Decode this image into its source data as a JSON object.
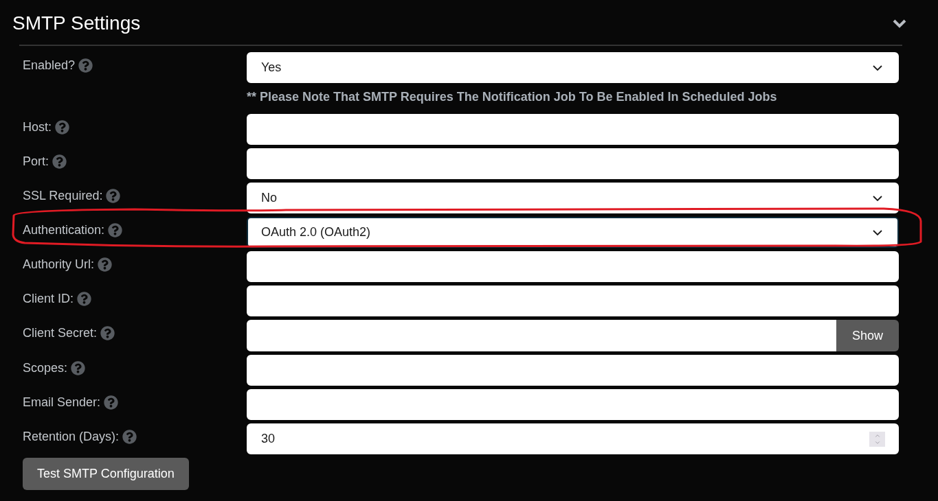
{
  "section": {
    "title": "SMTP Settings",
    "expanded": true
  },
  "note": "** Please Note That SMTP Requires The Notification Job To Be Enabled In Scheduled Jobs",
  "fields": [
    {
      "label": "Enabled?",
      "kind": "select",
      "value": "Yes",
      "focused": false
    },
    {
      "label": "Host:",
      "kind": "text",
      "focused": false
    },
    {
      "label": "Port:",
      "kind": "text",
      "focused": false
    },
    {
      "label": "SSL Required:",
      "kind": "select",
      "value": "No",
      "focused": false
    },
    {
      "label": "Authentication:",
      "kind": "select",
      "value": "OAuth 2.0 (OAuth2)",
      "focused": true,
      "highlighted": true
    },
    {
      "label": "Authority Url:",
      "kind": "text",
      "focused": false
    },
    {
      "label": "Client ID:",
      "kind": "text",
      "focused": false
    },
    {
      "label": "Client Secret:",
      "kind": "password",
      "button": "Show",
      "focused": false
    },
    {
      "label": "Scopes:",
      "kind": "text",
      "focused": false
    },
    {
      "label": "Email Sender:",
      "kind": "text",
      "focused": false
    },
    {
      "label": "Retention (Days):",
      "kind": "number",
      "value": "30",
      "focused": false
    }
  ],
  "test_button": "Test SMTP Configuration"
}
